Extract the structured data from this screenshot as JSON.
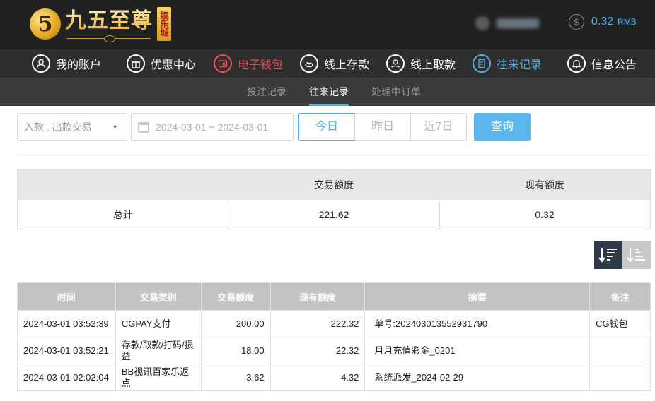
{
  "header": {
    "logo_mark": "5",
    "logo_title": "九五至尊",
    "logo_badge": "娱乐城",
    "balance_value": "0.32",
    "balance_unit": "RMB",
    "coin_symbol": "$"
  },
  "nav": [
    {
      "label": "我的账户",
      "icon": "user-icon"
    },
    {
      "label": "优惠中心",
      "icon": "gift-icon"
    },
    {
      "label": "电子钱包",
      "icon": "wallet-icon"
    },
    {
      "label": "线上存款",
      "icon": "deposit-icon"
    },
    {
      "label": "线上取款",
      "icon": "withdraw-icon"
    },
    {
      "label": "往来记录",
      "icon": "records-icon"
    },
    {
      "label": "信息公告",
      "icon": "bell-icon"
    }
  ],
  "subnav": [
    "投注记录",
    "往来记录",
    "处理中订单"
  ],
  "filters": {
    "type_select": "入款 . 出款交易",
    "date_range": "2024-03-01 ~ 2024-03-01",
    "quick": [
      "今日",
      "昨日",
      "近7日"
    ],
    "query_label": "查询"
  },
  "summary": {
    "headers": [
      "交易额度",
      "现有额度"
    ],
    "row_label": "总计",
    "values": [
      "221.62",
      "0.32"
    ]
  },
  "records": {
    "headers": [
      "时间",
      "交易类别",
      "交易额度",
      "现有额度",
      "摘要",
      "备注"
    ],
    "rows": [
      [
        "2024-03-01 03:52:39",
        "CGPAY支付",
        "200.00",
        "222.32",
        "单号:202403013552931790",
        "CG钱包"
      ],
      [
        "2024-03-01 03:52:21",
        "存款/取款/打码/损益",
        "18.00",
        "22.32",
        "月月充值彩金_0201",
        ""
      ],
      [
        "2024-03-01 02:02:04",
        "BB视讯百家乐返点",
        "3.62",
        "4.32",
        "系统派发_2024-02-29",
        ""
      ]
    ]
  },
  "colors": {
    "accent_blue": "#4fb0e8",
    "accent_red": "#e8505b",
    "header_bg": "#212121",
    "nav_bg": "#2e2e2e",
    "subnav_bg": "#3b3b3b"
  }
}
